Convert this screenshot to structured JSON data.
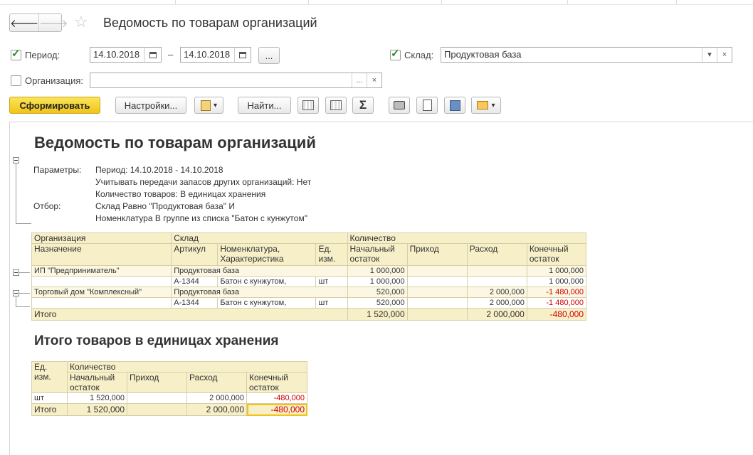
{
  "window": {
    "title": "Ведомость по товарам организаций"
  },
  "filters": {
    "period_label": "Период:",
    "date_from": "14.10.2018",
    "date_sep": "–",
    "date_to": "14.10.2018",
    "more": "...",
    "warehouse_label": "Склад:",
    "warehouse_value": "Продуктовая база",
    "org_label": "Организация:",
    "org_value": "",
    "dots": "...",
    "clear": "×",
    "dropdown": "▾"
  },
  "toolbar": {
    "generate": "Сформировать",
    "settings": "Настройки...",
    "find": "Найти...",
    "sum": "Σ",
    "caret": "▾"
  },
  "report": {
    "title": "Ведомость по товарам организаций",
    "params_label": "Параметры:",
    "params": [
      "Период: 14.10.2018 - 14.10.2018",
      "Учитывать передачи запасов других организаций: Нет",
      "Количество товаров: В единицах хранения"
    ],
    "filter_label": "Отбор:",
    "filter": [
      "Склад Равно \"Продуктовая база\" И",
      "Номенклатура В группе из списка \"Батон с кунжутом\""
    ],
    "headers": {
      "org": "Организация",
      "sklad": "Склад",
      "qty": "Количество",
      "purpose": "Назначение",
      "article": "Артикул",
      "nomen1": "Номенклатура,",
      "nomen2": "Характеристика",
      "unit1": "Ед.",
      "unit2": "изм.",
      "start1": "Начальный",
      "start2": "остаток",
      "income": "Приход",
      "expense": "Расход",
      "end1": "Конечный",
      "end2": "остаток"
    },
    "rows": [
      {
        "org": "ИП \"Предприниматель\"",
        "sklad": "Продуктовая база",
        "start": "1 000,000",
        "income": "",
        "expense": "",
        "end": "1 000,000",
        "article": "А-1344",
        "item": "Батон с кунжутом,",
        "unit": "шт",
        "istart": "1 000,000",
        "iincome": "",
        "iexpense": "",
        "iend": "1 000,000"
      },
      {
        "org": "Торговый дом \"Комплексный\"",
        "sklad": "Продуктовая база",
        "start": "520,000",
        "income": "",
        "expense": "2 000,000",
        "end": "-1 480,000",
        "article": "А-1344",
        "item": "Батон с кунжутом,",
        "unit": "шт",
        "istart": "520,000",
        "iincome": "",
        "iexpense": "2 000,000",
        "iend": "-1 480,000"
      }
    ],
    "total": {
      "label": "Итого",
      "start": "1 520,000",
      "income": "",
      "expense": "2 000,000",
      "end": "-480,000"
    },
    "subtitle": "Итого товаров в единицах хранения",
    "t2_headers": {
      "unit1": "Ед.",
      "unit2": "изм.",
      "qty": "Количество",
      "start1": "Начальный",
      "start2": "остаток",
      "income": "Приход",
      "expense": "Расход",
      "end1": "Конечный",
      "end2": "остаток"
    },
    "t2_row": {
      "unit": "шт",
      "start": "1 520,000",
      "income": "",
      "expense": "2 000,000",
      "end": "-480,000"
    },
    "t2_total": {
      "label": "Итого",
      "start": "1 520,000",
      "income": "",
      "expense": "2 000,000",
      "end": "-480,000"
    }
  },
  "colors": {
    "accent": "#f0c419",
    "negative": "#d40000",
    "header_bg": "#f6efc8",
    "check": "#2a8f2a"
  }
}
